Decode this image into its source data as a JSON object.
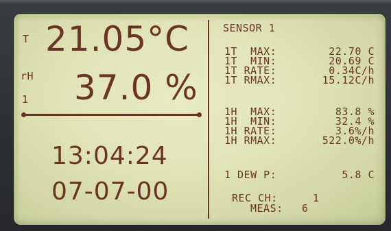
{
  "display": {
    "left": {
      "temp_label": "T",
      "temp_value": "21.05°C",
      "rh_label": "rH",
      "rh_value": "37.0 %",
      "channel": "1",
      "time": "13:04:24",
      "date": "07-07-00"
    },
    "right": {
      "sensor_title": "SENSOR 1",
      "temp_stats": [
        {
          "label": "1T  MAX:",
          "value": "22.70 C"
        },
        {
          "label": "1T  MIN:",
          "value": "20.69 C"
        },
        {
          "label": "1T RATE:",
          "value": "0.34C/h"
        },
        {
          "label": "1T RMAX:",
          "value": "15.12C/h"
        }
      ],
      "hum_stats": [
        {
          "label": "1H  MAX:",
          "value": "83.8 %"
        },
        {
          "label": "1H  MIN:",
          "value": "32.4 %"
        },
        {
          "label": "1H RATE:",
          "value": "3.6%/h"
        },
        {
          "label": "1H RMAX:",
          "value": "522.0%/h"
        }
      ],
      "dew": {
        "label": "1 DEW P:",
        "value": "5.8 C"
      },
      "rec_ch": {
        "label": "REC CH:",
        "value": "1"
      },
      "meas": {
        "label": "MEAS:",
        "value": "6"
      }
    }
  },
  "colors": {
    "lcd_background": "#dfe3b4",
    "segment_ink": "#6b3325",
    "bezel": "#2f3236"
  }
}
